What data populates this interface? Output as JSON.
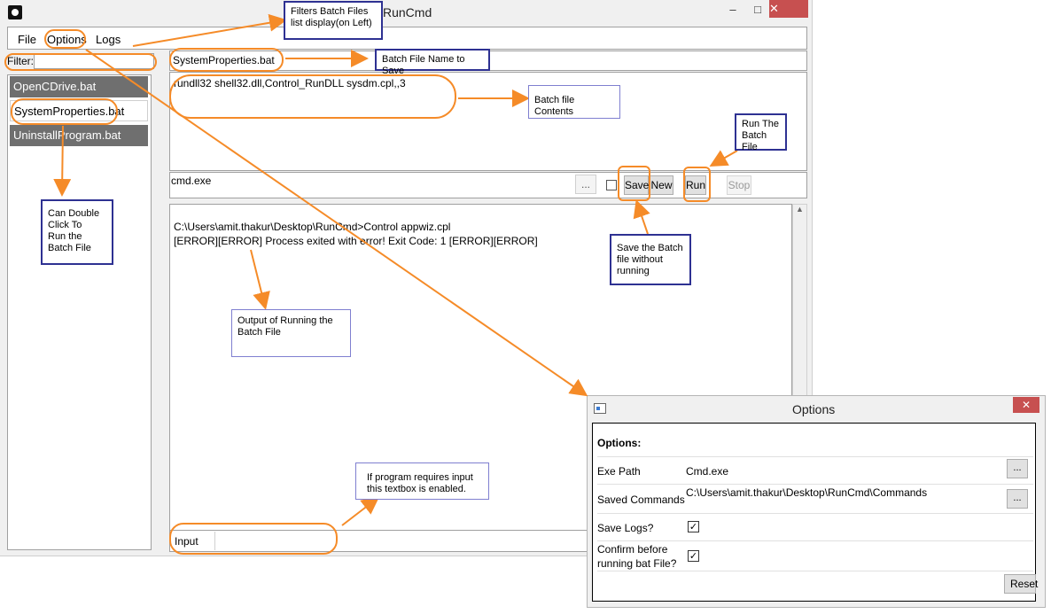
{
  "window": {
    "title": "RunCmd",
    "minimize": "–",
    "maximize": "□",
    "close": "✕"
  },
  "menu": [
    "File",
    "Options",
    "Logs"
  ],
  "filter": {
    "label": "Filter:",
    "value": ""
  },
  "files": [
    "OpenCDrive.bat",
    "SystemProperties.bat",
    "UninstallProgram.bat"
  ],
  "batch_name": "SystemProperties.bat",
  "batch_contents": "rundll32 shell32.dll,Control_RunDLL sysdm.cpl,,3",
  "toolbar": {
    "exe": "cmd.exe",
    "browse": "...",
    "save": "Save",
    "new": "New",
    "run": "Run",
    "stop": "Stop"
  },
  "output": [
    "C:\\Users\\amit.thakur\\Desktop\\RunCmd>Control appwiz.cpl",
    "[ERROR][ERROR] Process exited with error! Exit Code: 1 [ERROR][ERROR]"
  ],
  "input": {
    "label": "Input",
    "value": ""
  },
  "options_dialog": {
    "title": "Options",
    "close": "✕",
    "heading": "Options:",
    "exe_path_label": "Exe Path",
    "exe_path_value": "Cmd.exe",
    "saved_commands_label": "Saved Commands",
    "saved_commands_value": "C:\\Users\\amit.thakur\\Desktop\\RunCmd\\Commands",
    "browse": "...",
    "save_logs_label": "Save Logs?",
    "save_logs_checked": "✓",
    "confirm_label_1": "Confirm before",
    "confirm_label_2": "running bat File?",
    "confirm_checked": "✓",
    "reset": "Reset"
  },
  "annotations": {
    "filters": [
      "Filters Batch Files",
      "list display(on Left)"
    ],
    "batch_name": "Batch File Name to Save",
    "batch_contents": "Batch file Contents",
    "run": [
      "Run The",
      "Batch File"
    ],
    "double_click": [
      "Can Double",
      "Click To",
      "Run the",
      "Batch File"
    ],
    "save": [
      "Save the Batch",
      "file without",
      "running"
    ],
    "output": [
      "Output of Running the",
      "Batch File"
    ],
    "input": [
      "If program requires input",
      "this textbox is enabled."
    ]
  },
  "colors": {
    "annotation_arrow": "#f58b28",
    "annotation_box": "#2e3192",
    "selected_file_bg": "#ffffff",
    "file_bg": "#6f6f6f"
  }
}
